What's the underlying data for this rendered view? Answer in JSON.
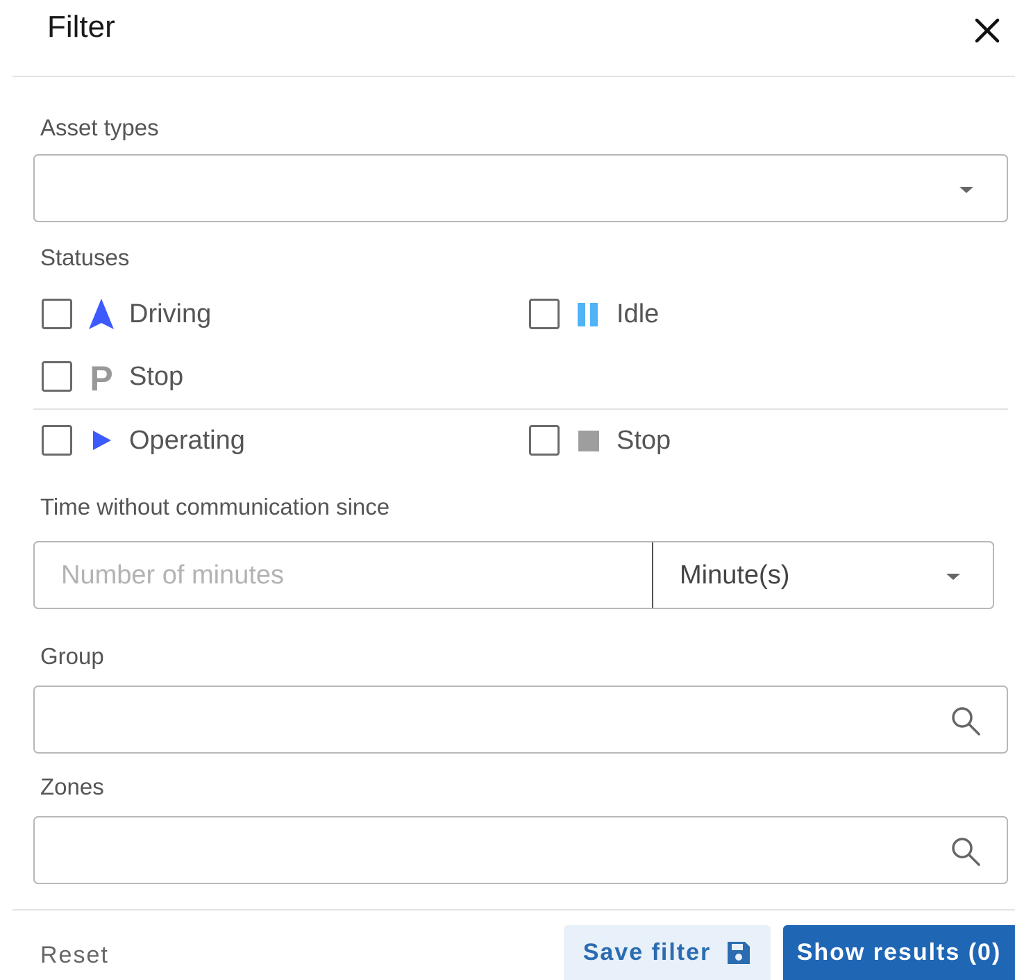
{
  "header": {
    "title": "Filter",
    "close_icon": "close-icon"
  },
  "asset_types": {
    "label": "Asset types",
    "value": "",
    "icon": "chevron-down-icon"
  },
  "statuses": {
    "label": "Statuses",
    "vehicle": [
      {
        "label": "Driving",
        "icon": "navigation-arrow-icon",
        "color": "#3d5afe",
        "checked": false
      },
      {
        "label": "Idle",
        "icon": "pause-icon",
        "color": "#4fb3f6",
        "checked": false
      },
      {
        "label": "Stop",
        "icon": "parking-icon",
        "color": "#999999",
        "checked": false
      }
    ],
    "equipment": [
      {
        "label": "Operating",
        "icon": "play-icon",
        "color": "#3d5afe",
        "checked": false
      },
      {
        "label": "Stop",
        "icon": "stop-square-icon",
        "color": "#9e9e9e",
        "checked": false
      }
    ]
  },
  "time_without_communication": {
    "label": "Time without communication since",
    "placeholder": "Number of minutes",
    "value": "",
    "unit": "Minute(s)",
    "unit_icon": "chevron-down-icon"
  },
  "group": {
    "label": "Group",
    "value": "",
    "icon": "search-icon"
  },
  "zones": {
    "label": "Zones",
    "value": "",
    "icon": "search-icon"
  },
  "footer": {
    "reset_label": "Reset",
    "save_label": "Save filter",
    "save_icon": "floppy-disk-icon",
    "show_results_label": "Show results (0)"
  },
  "colors": {
    "primary": "#1f66b5",
    "save_bg": "#e8f0f9",
    "save_text": "#2b6cb0"
  }
}
